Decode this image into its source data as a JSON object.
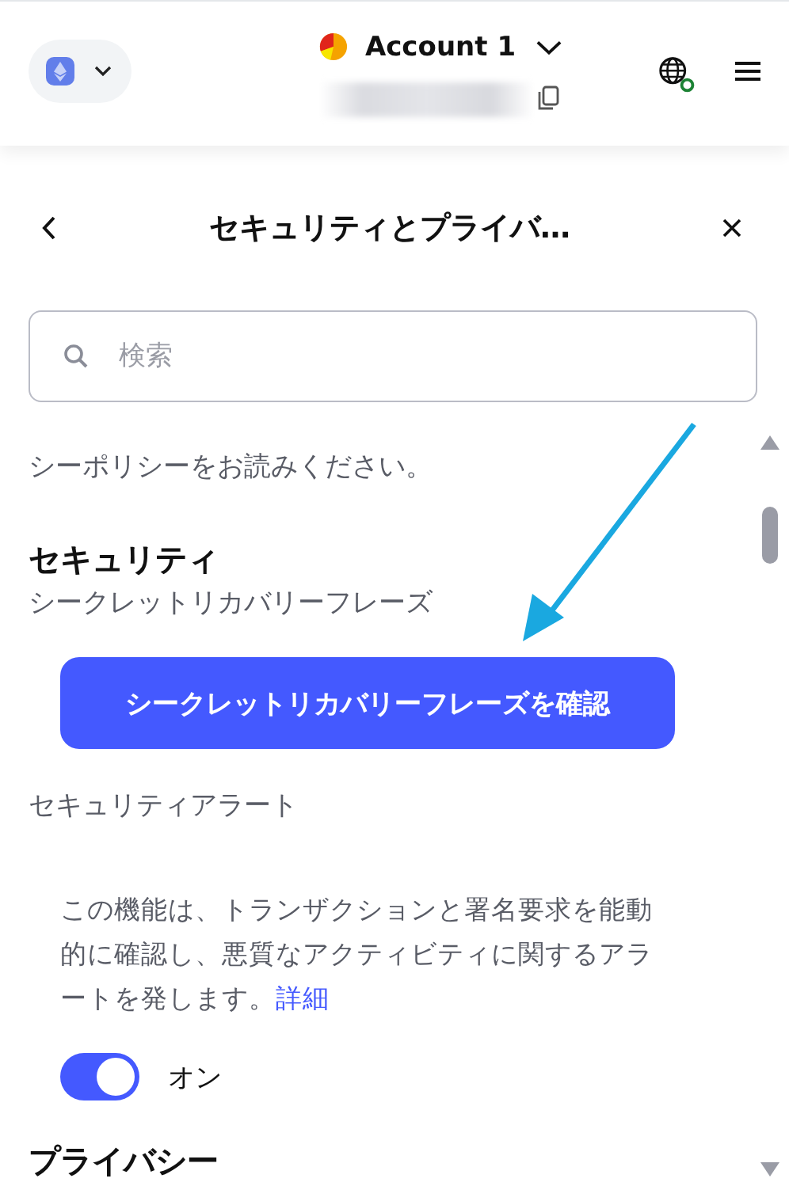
{
  "header": {
    "account_name": "Account 1"
  },
  "page": {
    "title": "セキュリティとプライバ…"
  },
  "search": {
    "placeholder": "検索"
  },
  "content": [
    {
      "kind": "paragraph",
      "text": "シーポリシーをお読みください。"
    },
    {
      "kind": "heading",
      "text": "セキュリティ"
    },
    {
      "kind": "label",
      "text": "シークレットリカバリーフレーズ"
    },
    {
      "kind": "button",
      "text": "シークレットリカバリーフレーズを確認"
    },
    {
      "kind": "label",
      "text": "セキュリティアラート"
    },
    {
      "kind": "description",
      "text": "この機能は、トランザクションと署名要求を能動的に確認し、悪質なアクティビティに関するアラートを発します。",
      "link": "詳細"
    },
    {
      "kind": "toggle",
      "on": true,
      "text": "オン"
    },
    {
      "kind": "heading",
      "text": "プライバシー"
    }
  ]
}
